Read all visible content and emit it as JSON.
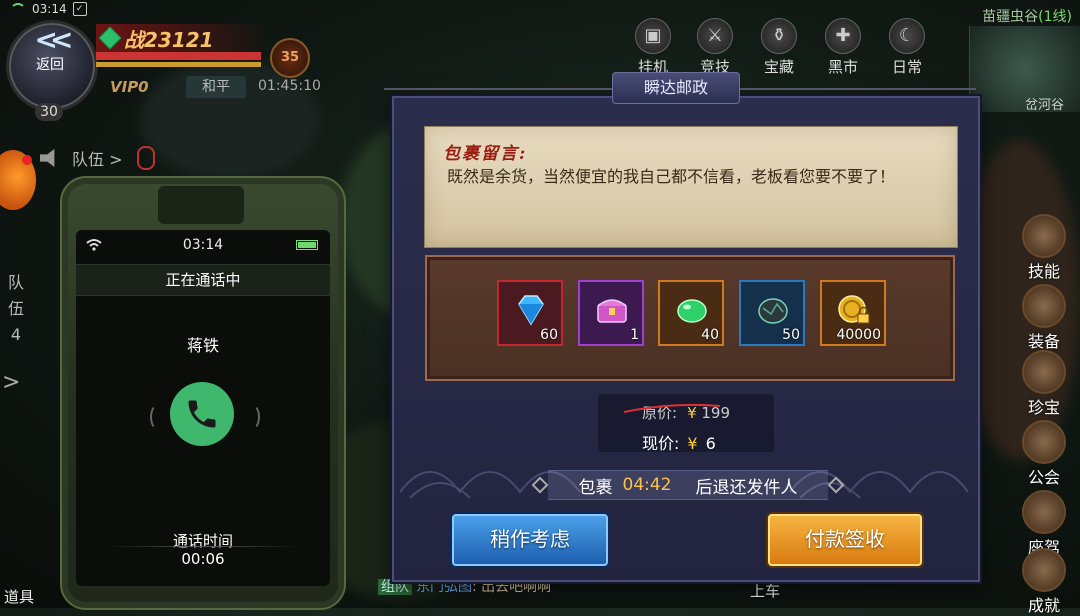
{
  "status_bar": {
    "time": "03:14"
  },
  "player": {
    "back_label": "返回",
    "level": "30",
    "power": "战23121",
    "rank": "35",
    "vip": "VIP0",
    "mode": "和平",
    "clock": "01:45:10"
  },
  "team": {
    "label": "队伍 >",
    "side_label_1": "队",
    "side_label_2": "伍",
    "side_count": "4"
  },
  "top_nav": [
    {
      "label": "挂机",
      "icon": "computer-icon"
    },
    {
      "label": "竞技",
      "icon": "arena-icon"
    },
    {
      "label": "宝藏",
      "icon": "treasure-icon"
    },
    {
      "label": "黑市",
      "icon": "black-market-icon"
    },
    {
      "label": "日常",
      "icon": "daily-icon"
    }
  ],
  "location": {
    "name": "苗疆虫谷",
    "line": "(1线)",
    "minimap_label": "岔河谷"
  },
  "side_menu": [
    {
      "label": "技能"
    },
    {
      "label": "装备"
    },
    {
      "label": "珍宝"
    },
    {
      "label": "公会"
    },
    {
      "label": "座驾"
    },
    {
      "label": "成就"
    }
  ],
  "bag_label": "道具",
  "get_on_label": "上车",
  "phone": {
    "time": "03:14",
    "title": "正在通话中",
    "caller": "蒋铁",
    "call_label": "通话时间",
    "call_time": "00:06"
  },
  "chat": {
    "tag": "组队",
    "name": "东门弘图",
    "message": ": 出去吧啊啊"
  },
  "dialog": {
    "title": "瞬达邮政",
    "letter_heading": "包裹留言:",
    "letter_body": "既然是余货，当然便宜的我自己都不信看，老板看您要不要了！",
    "items": [
      {
        "name": "diamond",
        "qty": "60",
        "border": "#c0282e",
        "bg": "#4a1a20"
      },
      {
        "name": "treasure-chest",
        "qty": "1",
        "border": "#a040d0",
        "bg": "#3c1a50"
      },
      {
        "name": "green-bean",
        "qty": "40",
        "border": "#d07a20",
        "bg": "#4a2c14"
      },
      {
        "name": "dark-ore",
        "qty": "50",
        "border": "#2a7ac0",
        "bg": "#14304a"
      },
      {
        "name": "gold-coin-locked",
        "qty": "40000",
        "border": "#d07a20",
        "bg": "#4a2c14"
      }
    ],
    "original_price_label": "原价:",
    "original_price_value": "199",
    "current_price_label": "现价:",
    "current_price_value": "6",
    "currency_symbol": "¥",
    "timer_prefix": "包裹",
    "timer_value": "04:42",
    "timer_suffix": "后退还发件人",
    "cancel_label": "稍作考虑",
    "confirm_label": "付款签收"
  }
}
